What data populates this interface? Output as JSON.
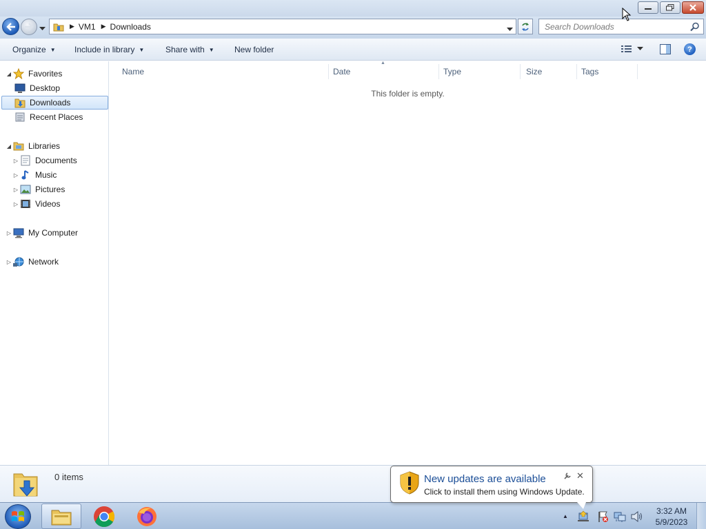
{
  "address": {
    "crumbs": [
      "VM1",
      "Downloads"
    ],
    "search_placeholder": "Search Downloads"
  },
  "toolbar": {
    "organize": "Organize",
    "include_in_library": "Include in library",
    "share_with": "Share with",
    "new_folder": "New folder"
  },
  "nav": {
    "favorites": "Favorites",
    "desktop": "Desktop",
    "downloads": "Downloads",
    "recent_places": "Recent Places",
    "libraries": "Libraries",
    "documents": "Documents",
    "music": "Music",
    "pictures": "Pictures",
    "videos": "Videos",
    "my_computer": "My Computer",
    "network": "Network",
    "selected": "Downloads"
  },
  "columns": [
    "Name",
    "Date",
    "Type",
    "Size",
    "Tags"
  ],
  "content": {
    "empty_message": "This folder is empty."
  },
  "details": {
    "count": "0 items"
  },
  "notification": {
    "title": "New updates are available",
    "text": "Click to install them using Windows Update."
  },
  "clock": {
    "time": "3:32 AM",
    "date": "5/9/2023"
  },
  "icons": {
    "back": "back-arrow-icon",
    "forward": "forward-arrow-icon",
    "refresh": "refresh-icon",
    "search": "search-icon",
    "help": "help-icon",
    "start": "windows-start-icon",
    "shield": "warning-shield-icon"
  },
  "colors": {
    "accent": "#1f5fbf",
    "selection": "#d2e5fa",
    "notification_title": "#1b4e97"
  }
}
